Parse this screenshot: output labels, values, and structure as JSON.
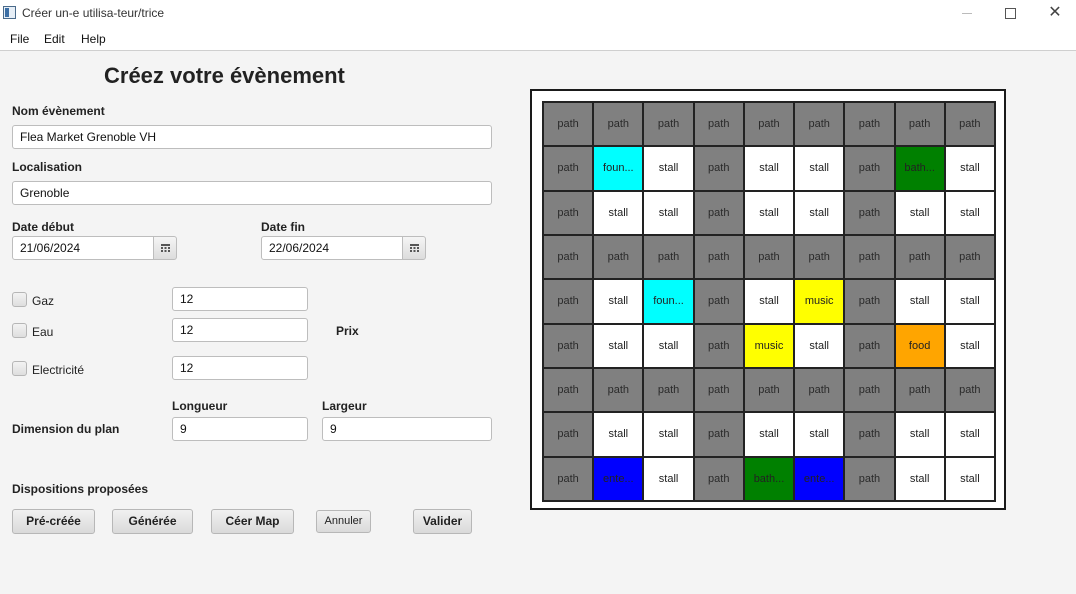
{
  "window": {
    "title": "Créer un-e utilisa-teur/trice",
    "minimize": "—",
    "maximize": "☐",
    "close": "✕"
  },
  "menu": [
    "File",
    "Edit",
    "Help"
  ],
  "form": {
    "heading": "Créez votre évènement",
    "event_name_label": "Nom évènement",
    "event_name_value": "Flea Market Grenoble VH",
    "location_label": "Localisation",
    "location_value": "Grenoble",
    "start_date_label": "Date début",
    "start_date_value": "21/06/2024",
    "end_date_label": "Date fin",
    "end_date_value": "22/06/2024",
    "gas_label": "Gaz",
    "gas_price": "12",
    "water_label": "Eau",
    "water_price": "12",
    "electricity_label": "Electricité",
    "electricity_price": "12",
    "price_label": "Prix",
    "dimension_label": "Dimension du plan",
    "length_label": "Longueur",
    "length_value": "9",
    "width_label": "Largeur",
    "width_value": "9",
    "layouts_label": "Dispositions proposées",
    "checked": {
      "gas": false,
      "water": false,
      "electricity": false
    }
  },
  "buttons": {
    "precreated": "Pré-créée",
    "generated": "Générée",
    "create_map": "Céer Map",
    "cancel": "Annuler",
    "validate": "Valider"
  },
  "map": {
    "rows": [
      [
        {
          "t": "path",
          "l": "path"
        },
        {
          "t": "path",
          "l": "path"
        },
        {
          "t": "path",
          "l": "path"
        },
        {
          "t": "path",
          "l": "path"
        },
        {
          "t": "path",
          "l": "path"
        },
        {
          "t": "path",
          "l": "path"
        },
        {
          "t": "path",
          "l": "path"
        },
        {
          "t": "path",
          "l": "path"
        },
        {
          "t": "path",
          "l": "path"
        }
      ],
      [
        {
          "t": "path",
          "l": "path"
        },
        {
          "t": "fountain",
          "l": "foun..."
        },
        {
          "t": "stall",
          "l": "stall"
        },
        {
          "t": "path",
          "l": "path"
        },
        {
          "t": "stall",
          "l": "stall"
        },
        {
          "t": "stall",
          "l": "stall"
        },
        {
          "t": "path",
          "l": "path"
        },
        {
          "t": "bathroom",
          "l": "bath..."
        },
        {
          "t": "stall",
          "l": "stall"
        }
      ],
      [
        {
          "t": "path",
          "l": "path"
        },
        {
          "t": "stall",
          "l": "stall"
        },
        {
          "t": "stall",
          "l": "stall"
        },
        {
          "t": "path",
          "l": "path"
        },
        {
          "t": "stall",
          "l": "stall"
        },
        {
          "t": "stall",
          "l": "stall"
        },
        {
          "t": "path",
          "l": "path"
        },
        {
          "t": "stall",
          "l": "stall"
        },
        {
          "t": "stall",
          "l": "stall"
        }
      ],
      [
        {
          "t": "path",
          "l": "path"
        },
        {
          "t": "path",
          "l": "path"
        },
        {
          "t": "path",
          "l": "path"
        },
        {
          "t": "path",
          "l": "path"
        },
        {
          "t": "path",
          "l": "path"
        },
        {
          "t": "path",
          "l": "path"
        },
        {
          "t": "path",
          "l": "path"
        },
        {
          "t": "path",
          "l": "path"
        },
        {
          "t": "path",
          "l": "path"
        }
      ],
      [
        {
          "t": "path",
          "l": "path"
        },
        {
          "t": "stall",
          "l": "stall"
        },
        {
          "t": "fountain",
          "l": "foun..."
        },
        {
          "t": "path",
          "l": "path"
        },
        {
          "t": "stall",
          "l": "stall"
        },
        {
          "t": "music",
          "l": "music"
        },
        {
          "t": "path",
          "l": "path"
        },
        {
          "t": "stall",
          "l": "stall"
        },
        {
          "t": "stall",
          "l": "stall"
        }
      ],
      [
        {
          "t": "path",
          "l": "path"
        },
        {
          "t": "stall",
          "l": "stall"
        },
        {
          "t": "stall",
          "l": "stall"
        },
        {
          "t": "path",
          "l": "path"
        },
        {
          "t": "music",
          "l": "music"
        },
        {
          "t": "stall",
          "l": "stall"
        },
        {
          "t": "path",
          "l": "path"
        },
        {
          "t": "food",
          "l": "food"
        },
        {
          "t": "stall",
          "l": "stall"
        }
      ],
      [
        {
          "t": "path",
          "l": "path"
        },
        {
          "t": "path",
          "l": "path"
        },
        {
          "t": "path",
          "l": "path"
        },
        {
          "t": "path",
          "l": "path"
        },
        {
          "t": "path",
          "l": "path"
        },
        {
          "t": "path",
          "l": "path"
        },
        {
          "t": "path",
          "l": "path"
        },
        {
          "t": "path",
          "l": "path"
        },
        {
          "t": "path",
          "l": "path"
        }
      ],
      [
        {
          "t": "path",
          "l": "path"
        },
        {
          "t": "stall",
          "l": "stall"
        },
        {
          "t": "stall",
          "l": "stall"
        },
        {
          "t": "path",
          "l": "path"
        },
        {
          "t": "stall",
          "l": "stall"
        },
        {
          "t": "stall",
          "l": "stall"
        },
        {
          "t": "path",
          "l": "path"
        },
        {
          "t": "stall",
          "l": "stall"
        },
        {
          "t": "stall",
          "l": "stall"
        }
      ],
      [
        {
          "t": "path",
          "l": "path"
        },
        {
          "t": "entrance",
          "l": "ente..."
        },
        {
          "t": "stall",
          "l": "stall"
        },
        {
          "t": "path",
          "l": "path"
        },
        {
          "t": "bathroom",
          "l": "bath..."
        },
        {
          "t": "entrance",
          "l": "ente..."
        },
        {
          "t": "path",
          "l": "path"
        },
        {
          "t": "stall",
          "l": "stall"
        },
        {
          "t": "stall",
          "l": "stall"
        }
      ]
    ],
    "colors": {
      "path": "#808080",
      "stall": "#ffffff",
      "fountain": "#00ffff",
      "music": "#ffff00",
      "food": "#ffa500",
      "bathroom": "#008000",
      "entrance": "#0000ff"
    }
  }
}
